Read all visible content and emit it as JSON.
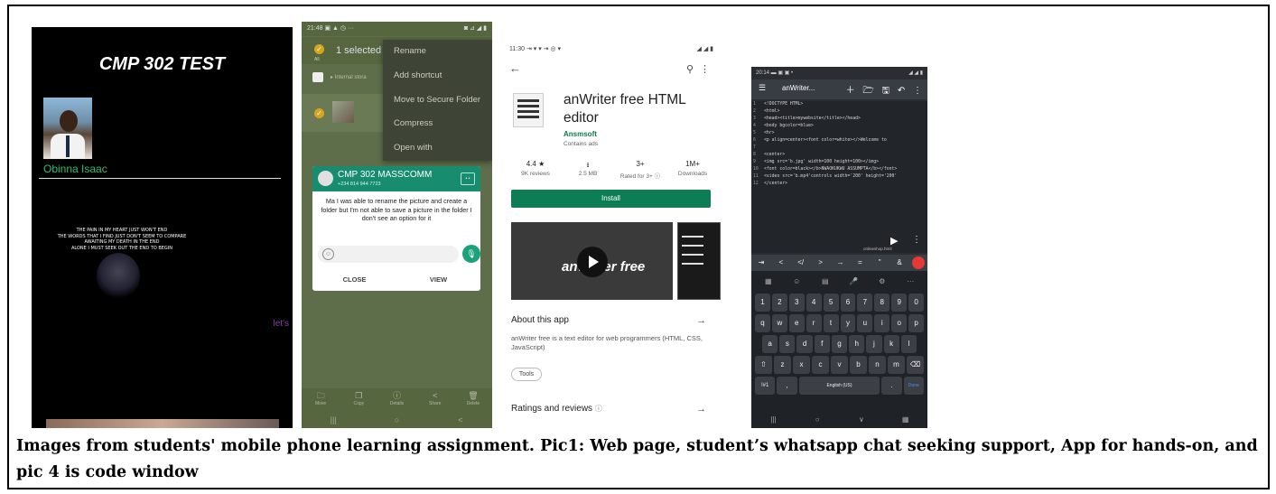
{
  "pic1": {
    "title": "CMP 302 TEST",
    "name": "Obinna Isaac",
    "poem": [
      "THE PAIN IN MY HEART JUST WON'T END",
      "THE WORDS THAT I FIND JUST DON'T SEEM TO COMPARE",
      "AWAITING MY DEATH IN THE END",
      "ALONE I MUST SEEK OUT THE END TO BEGIN"
    ],
    "lets_text": "let's",
    "colors": {
      "name": "#2fbf71",
      "lets": "#8a3fa8"
    }
  },
  "pic2": {
    "status_time": "21:48",
    "status_icons": "▣ ▲ ◷ ···",
    "status_right": "◙ ⊿ ◢ ▮",
    "selected": "1 selected",
    "all_label": "All",
    "path": "▸ Internal stora",
    "menu": [
      "Rename",
      "Add shortcut",
      "Move to Secure Folder",
      "Compress",
      "Open with"
    ],
    "chat_name": "CMP 302 MASSCOMM",
    "chat_number": "+234 814 944 7723",
    "message": "Ma I was able to rename the picture and create a folder but I'm not able to save a picture in the folder I don't see an option for it",
    "close_label": "CLOSE",
    "view_label": "VIEW",
    "actions": [
      {
        "icon": "folder-move-icon",
        "label": "Move"
      },
      {
        "icon": "copy-icon",
        "label": "Copy"
      },
      {
        "icon": "info-icon",
        "label": "Details"
      },
      {
        "icon": "share-icon",
        "label": "Share"
      },
      {
        "icon": "trash-icon",
        "label": "Delete"
      }
    ],
    "nav": [
      "|||",
      "○",
      "<"
    ],
    "colors": {
      "header": "#178c6f",
      "check": "#d6a51d"
    }
  },
  "pic3": {
    "status_time": "11:30",
    "app_name": "anWriter free HTML editor",
    "developer": "Ansmsoft",
    "ads": "Contains ads",
    "stats": [
      {
        "value": "4.4 ★",
        "label": "9K reviews"
      },
      {
        "value": "⭳",
        "label": "2.5 MB"
      },
      {
        "value": "3+",
        "label": "Rated for 3+ ⓘ"
      },
      {
        "value": "1M+",
        "label": "Downloads"
      }
    ],
    "install": "Install",
    "video_logo": "anWriter free",
    "about_title": "About this app",
    "about_desc": "anWriter free is a text editor for web programmers (HTML, CSS, JavaScript)",
    "tag": "Tools",
    "ratings": "Ratings and reviews",
    "colors": {
      "install": "#0d7d55",
      "developer": "#0d7a4a"
    }
  },
  "pic4": {
    "status_time": "20:14",
    "title": "anWriter...",
    "code_lines": [
      "<!DOCTYPE HTML>",
      "<html>",
      "<head><title>mywebsite</title></head>",
      "<body bgcolor=blue>",
      "<hr>",
      "<p align=center><font color=white></>Welcome to",
      "",
      "<center>",
      "<img src='b.jpg' width=100 height=100></img>",
      "<font color=black></b>NWAOKUKWU ASSUMPTA</b></font>",
      "<video src='b.mp4'controls width='200' height='200'",
      "</center>"
    ],
    "file_name": "onlineshop.html",
    "symbols": [
      "⇥",
      "<",
      "</",
      ">",
      "→",
      "=",
      "\"",
      "&"
    ],
    "keyboard": [
      [
        "▦",
        "☺",
        "▤",
        "🎤",
        "⚙",
        "···"
      ],
      [
        "1",
        "2",
        "3",
        "4",
        "5",
        "6",
        "7",
        "8",
        "9",
        "0"
      ],
      [
        "q",
        "w",
        "e",
        "r",
        "t",
        "y",
        "u",
        "i",
        "o",
        "p"
      ],
      [
        "a",
        "s",
        "d",
        "f",
        "g",
        "h",
        "j",
        "k",
        "l"
      ],
      [
        "⇧",
        "z",
        "x",
        "c",
        "v",
        "b",
        "n",
        "m",
        "⌫"
      ],
      [
        "!#1",
        ",",
        "English (US)",
        ".",
        "Done"
      ]
    ],
    "nav": [
      "|||",
      "○",
      "∨",
      "▦"
    ]
  },
  "caption": "Images from students' mobile phone learning assignment. Pic1: Web page, student’s whatsapp chat seeking support, App for hands-on, and pic 4 is code window"
}
